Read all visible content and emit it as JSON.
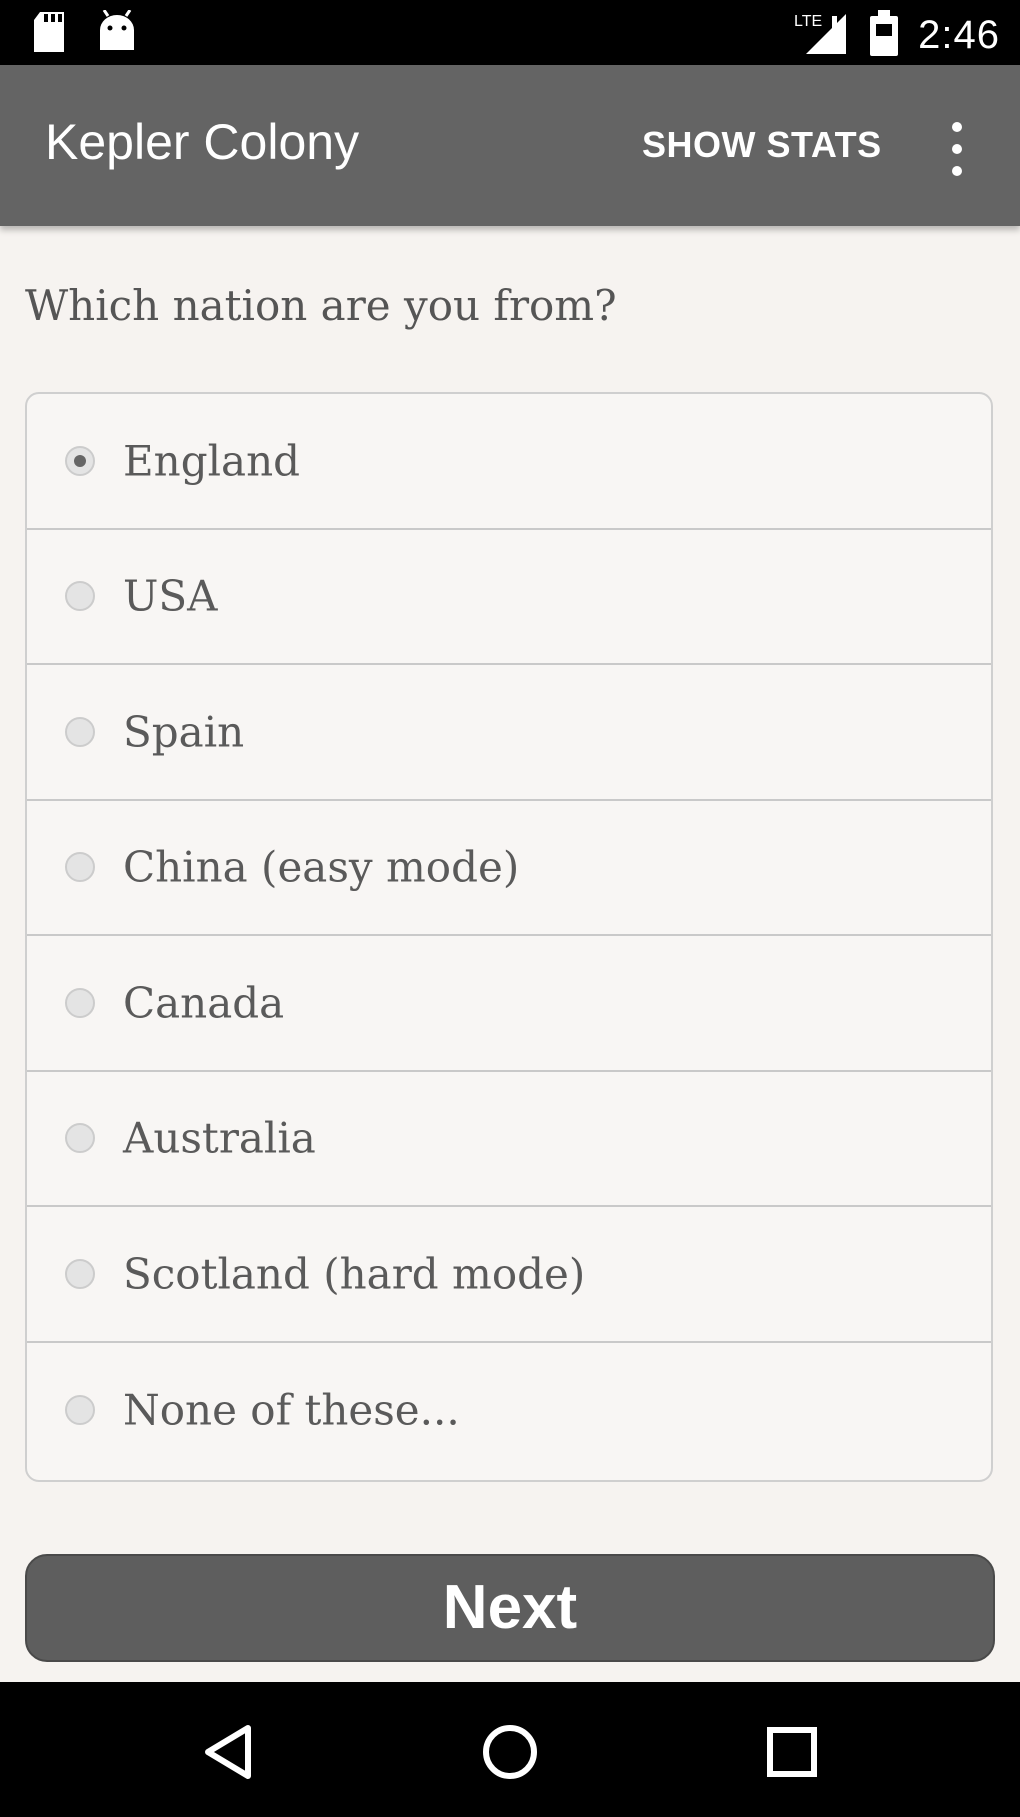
{
  "status_bar": {
    "time": "2:46",
    "icons": [
      "sd-card-icon",
      "android-icon",
      "signal-icon",
      "battery-icon"
    ]
  },
  "app_bar": {
    "title": "Kepler Colony",
    "action_label": "SHOW STATS",
    "menu_icon": "more-vert-icon"
  },
  "question": "Which nation are you from?",
  "options": [
    {
      "label": "England",
      "selected": true
    },
    {
      "label": "USA",
      "selected": false
    },
    {
      "label": "Spain",
      "selected": false
    },
    {
      "label": "China (easy mode)",
      "selected": false
    },
    {
      "label": "Canada",
      "selected": false
    },
    {
      "label": "Australia",
      "selected": false
    },
    {
      "label": "Scotland (hard mode)",
      "selected": false
    },
    {
      "label": "None of these...",
      "selected": false
    }
  ],
  "next_label": "Next",
  "nav_bar": {
    "icons": [
      "back-icon",
      "home-icon",
      "recents-icon"
    ]
  },
  "colors": {
    "app_bar": "#646464",
    "background": "#f6f3f0",
    "button": "#5e5e5e"
  }
}
